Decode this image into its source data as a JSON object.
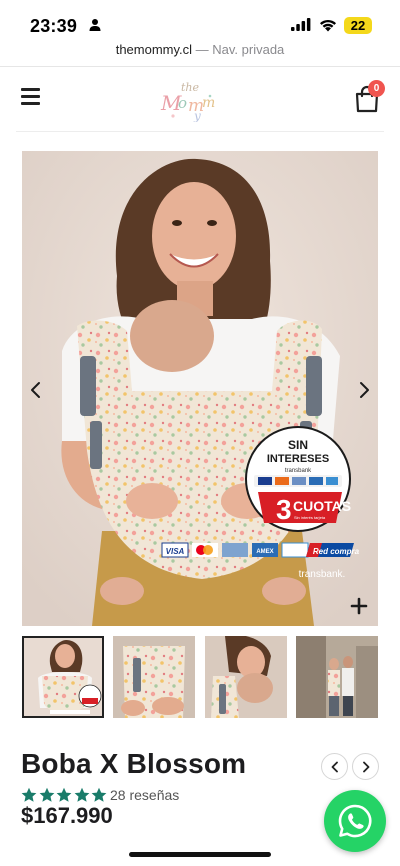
{
  "status_bar": {
    "time": "23:39",
    "battery": "22",
    "battery_color": "#f4d81b"
  },
  "browser": {
    "domain": "themommy.cl",
    "private_label": "— Nav. privada"
  },
  "header": {
    "menu_icon": "hamburger-icon",
    "cart_icon": "shopping-bag-icon",
    "cart_count": "0",
    "badge_color": "#f0544f"
  },
  "gallery": {
    "prev_icon": "chevron-left-icon",
    "next_icon": "chevron-right-icon",
    "zoom_icon": "plus-icon",
    "badge": {
      "line1": "SIN",
      "line2": "INTERESES",
      "transbank_small": "transbank",
      "big_number": "3",
      "big_label": "CUOTAS",
      "small_note": "Sin interés tarjeta"
    },
    "payment_strip": {
      "cards": [
        "VISA",
        "",
        "",
        "AMEX",
        ""
      ],
      "red_compra": "Red compra",
      "transbank": "transbank."
    },
    "thumbnail_count": 4,
    "active_thumbnail": 0
  },
  "product": {
    "title": "Boba X Blossom",
    "rating": 5,
    "rating_color": "#1a7c6a",
    "reviews": "28 reseñas",
    "price": "$167.990",
    "prev_icon": "chevron-left-icon",
    "next_icon": "chevron-right-icon"
  },
  "floating": {
    "whatsapp_icon": "whatsapp-icon",
    "whatsapp_color": "#25d366"
  }
}
